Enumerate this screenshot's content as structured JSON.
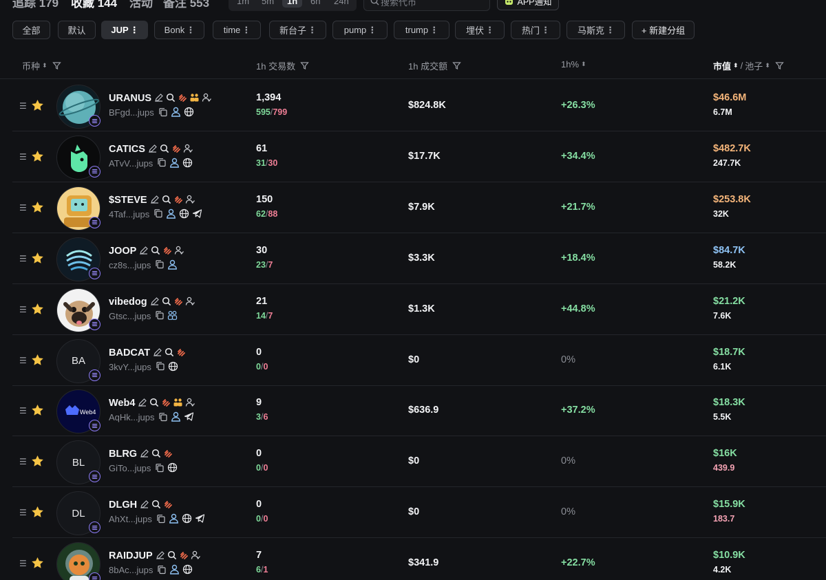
{
  "top_tabs": [
    {
      "label": "追踪 179"
    },
    {
      "label": "收藏 144"
    },
    {
      "label": "活动"
    },
    {
      "label": "备注 553"
    }
  ],
  "timeframes": [
    "1m",
    "5m",
    "1h",
    "6h",
    "24h"
  ],
  "timeframe_selected": "1h",
  "search": {
    "placeholder": "搜索代币"
  },
  "app_notify": "APP通知",
  "groups": [
    {
      "label": "全部"
    },
    {
      "label": "默认"
    },
    {
      "label": "JUP"
    },
    {
      "label": "Bonk"
    },
    {
      "label": "time"
    },
    {
      "label": "新台子"
    },
    {
      "label": "pump"
    },
    {
      "label": "trump"
    },
    {
      "label": "埋伏"
    },
    {
      "label": "热门"
    },
    {
      "label": "马斯克"
    },
    {
      "label": "+ 新建分组"
    }
  ],
  "group_selected": "JUP",
  "columns": {
    "token": "币种",
    "tx": "1h 交易数",
    "volume": "1h 成交额",
    "change": "1h%",
    "mcap": "市值",
    "pool_sep": "/",
    "pool": "池子"
  },
  "colors": {
    "buy": "#7fd99a",
    "sell": "#f07f96",
    "positive": "#86dfa3",
    "mcap_orange": "#f5b57a",
    "mcap_blue": "#8fc3f5",
    "mcap_green": "#86dfa3",
    "star": "#f6c446",
    "chain_badge": "#8d7cf7"
  },
  "rows": [
    {
      "name": "URANUS",
      "avatar_icon": "uranus-planet-icon",
      "avatar_text": "",
      "address": "BFgd...jups",
      "tx": "1,394",
      "buys": "595",
      "sells": "799",
      "volume": "$824.8K",
      "change": "+26.3%",
      "mcap": "$46.6M",
      "mcap_color": "#f5b57a",
      "pool": "6.7M",
      "pool_color": "#f3f4f6",
      "name_icons": [
        "edit-icon",
        "search-icon",
        "fire-icon",
        "holders-icon",
        "dev-icon"
      ],
      "addr_icons": [
        "copy-icon",
        "person-icon",
        "globe-icon"
      ]
    },
    {
      "name": "CATICS",
      "avatar_icon": "catics-logo-icon",
      "avatar_text": "",
      "address": "ATvV...jups",
      "tx": "61",
      "buys": "31",
      "sells": "30",
      "volume": "$17.7K",
      "change": "+34.4%",
      "mcap": "$482.7K",
      "mcap_color": "#f5b57a",
      "pool": "247.7K",
      "pool_color": "#f3f4f6",
      "name_icons": [
        "edit-icon",
        "search-icon",
        "fire-icon",
        "dev-icon"
      ],
      "addr_icons": [
        "copy-icon",
        "person-icon",
        "globe-icon"
      ]
    },
    {
      "name": "$STEVE",
      "avatar_icon": "steve-robot-icon",
      "avatar_text": "",
      "address": "4Taf...jups",
      "tx": "150",
      "buys": "62",
      "sells": "88",
      "volume": "$7.9K",
      "change": "+21.7%",
      "mcap": "$253.8K",
      "mcap_color": "#f5b57a",
      "pool": "32K",
      "pool_color": "#f3f4f6",
      "name_icons": [
        "edit-icon",
        "search-icon",
        "fire-icon",
        "dev-icon"
      ],
      "addr_icons": [
        "copy-icon",
        "person-icon",
        "globe-icon",
        "telegram-icon"
      ]
    },
    {
      "name": "JOOP",
      "avatar_icon": "joop-waves-icon",
      "avatar_text": "",
      "address": "cz8s...jups",
      "tx": "30",
      "buys": "23",
      "sells": "7",
      "volume": "$3.3K",
      "change": "+18.4%",
      "mcap": "$84.7K",
      "mcap_color": "#8fc3f5",
      "pool": "58.2K",
      "pool_color": "#f3f4f6",
      "name_icons": [
        "edit-icon",
        "search-icon",
        "fire-icon",
        "dev-icon"
      ],
      "addr_icons": [
        "copy-icon",
        "person-icon"
      ]
    },
    {
      "name": "vibedog",
      "avatar_icon": "pug-dog-icon",
      "avatar_text": "",
      "address": "Gtsc...jups",
      "tx": "21",
      "buys": "14",
      "sells": "7",
      "volume": "$1.3K",
      "change": "+44.8%",
      "mcap": "$21.2K",
      "mcap_color": "#86dfa3",
      "pool": "7.6K",
      "pool_color": "#f3f4f6",
      "name_icons": [
        "edit-icon",
        "search-icon",
        "fire-icon",
        "dev-icon"
      ],
      "addr_icons": [
        "copy-icon",
        "holders-icon"
      ]
    },
    {
      "name": "BADCAT",
      "avatar_icon": "",
      "avatar_text": "BA",
      "address": "3kvY...jups",
      "tx": "0",
      "buys": "0",
      "sells": "0",
      "volume": "$0",
      "change": "0%",
      "mcap": "$18.7K",
      "mcap_color": "#86dfa3",
      "pool": "6.1K",
      "pool_color": "#f3f4f6",
      "name_icons": [
        "edit-icon",
        "search-icon",
        "fire-icon"
      ],
      "addr_icons": [
        "copy-icon",
        "globe-icon"
      ]
    },
    {
      "name": "Web4",
      "avatar_icon": "web4-logo-icon",
      "avatar_text": "Web4",
      "address": "AqHk...jups",
      "tx": "9",
      "buys": "3",
      "sells": "6",
      "volume": "$636.9",
      "change": "+37.2%",
      "mcap": "$18.3K",
      "mcap_color": "#86dfa3",
      "pool": "5.5K",
      "pool_color": "#f3f4f6",
      "name_icons": [
        "edit-icon",
        "search-icon",
        "fire-icon",
        "holders-icon",
        "dev-icon"
      ],
      "addr_icons": [
        "copy-icon",
        "person-icon",
        "telegram-icon"
      ]
    },
    {
      "name": "BLRG",
      "avatar_icon": "",
      "avatar_text": "BL",
      "address": "GiTo...jups",
      "tx": "0",
      "buys": "0",
      "sells": "0",
      "volume": "$0",
      "change": "0%",
      "mcap": "$16K",
      "mcap_color": "#86dfa3",
      "pool": "439.9",
      "pool_color": "#f5a3b4",
      "name_icons": [
        "edit-icon",
        "search-icon",
        "fire-icon"
      ],
      "addr_icons": [
        "copy-icon",
        "globe-icon"
      ]
    },
    {
      "name": "DLGH",
      "avatar_icon": "",
      "avatar_text": "DL",
      "address": "AhXt...jups",
      "tx": "0",
      "buys": "0",
      "sells": "0",
      "volume": "$0",
      "change": "0%",
      "mcap": "$15.9K",
      "mcap_color": "#86dfa3",
      "pool": "183.7",
      "pool_color": "#f5a3b4",
      "name_icons": [
        "edit-icon",
        "search-icon",
        "fire-icon"
      ],
      "addr_icons": [
        "copy-icon",
        "person-icon",
        "globe-icon",
        "telegram-icon"
      ]
    },
    {
      "name": "RAIDJUP",
      "avatar_icon": "astronaut-cat-icon",
      "avatar_text": "",
      "address": "8bAc...jups",
      "tx": "7",
      "buys": "6",
      "sells": "1",
      "volume": "$341.9",
      "change": "+22.7%",
      "mcap": "$10.9K",
      "mcap_color": "#86dfa3",
      "pool": "4.2K",
      "pool_color": "#f3f4f6",
      "name_icons": [
        "edit-icon",
        "search-icon",
        "fire-icon",
        "dev-icon"
      ],
      "addr_icons": [
        "copy-icon",
        "person-icon",
        "globe-icon"
      ]
    }
  ]
}
